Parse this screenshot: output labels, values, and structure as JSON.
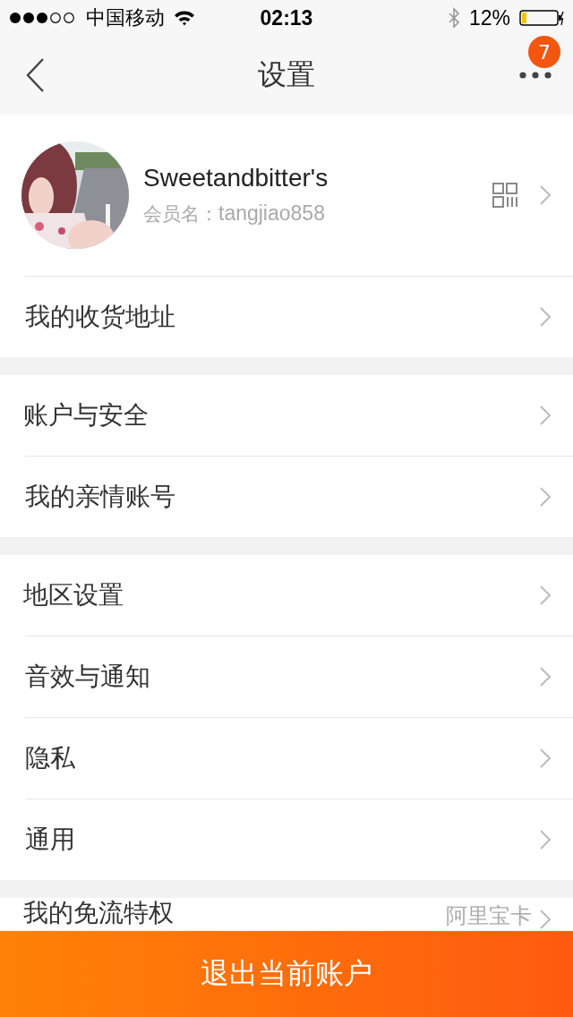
{
  "status_bar": {
    "carrier": "中国移动",
    "time": "02:13",
    "battery": "12%"
  },
  "nav": {
    "title": "设置",
    "badge": "7"
  },
  "profile": {
    "name": "Sweetandbitter's",
    "member_label": "会员名：",
    "member_id": "tangjiao858"
  },
  "sections": [
    [
      {
        "label": "我的收货地址"
      }
    ],
    [
      {
        "label": "账户与安全"
      },
      {
        "label": "我的亲情账号"
      }
    ],
    [
      {
        "label": "地区设置"
      },
      {
        "label": "音效与通知"
      },
      {
        "label": "隐私"
      },
      {
        "label": "通用"
      }
    ],
    [
      {
        "label": "我的免流特权",
        "value": "阿里宝卡"
      }
    ]
  ],
  "logout_button": "退出当前账户"
}
